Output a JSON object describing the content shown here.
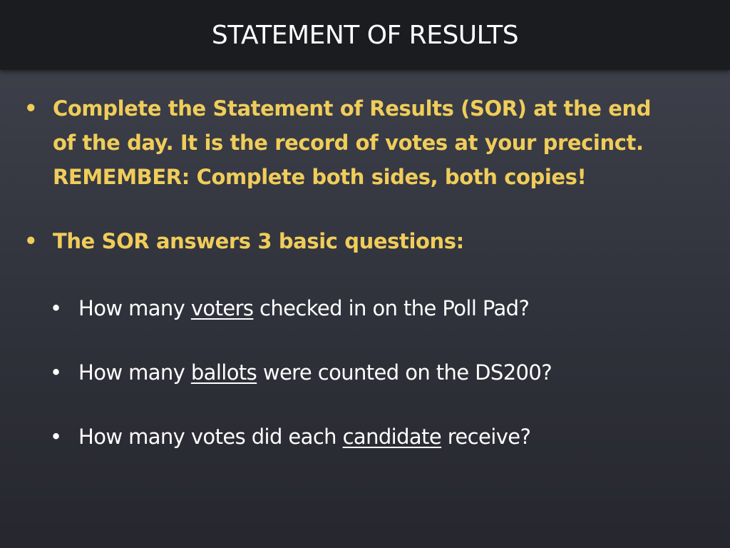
{
  "slide": {
    "title": "STATEMENT OF RESULTS",
    "bullets": [
      {
        "lines": [
          "Complete the Statement of Results (SOR) at the end",
          "of the day. It is the record of votes at your precinct.",
          "REMEMBER: Complete both sides, both copies!"
        ]
      },
      {
        "text": "The SOR answers 3 basic questions:"
      }
    ],
    "sub_bullets": [
      {
        "before": "How many ",
        "underlined": "voters",
        "after": " checked in on the Poll Pad?"
      },
      {
        "before": "How many ",
        "underlined": "ballots",
        "after": " were counted on the DS200?"
      },
      {
        "before": "How many votes did each ",
        "underlined": "candidate",
        "after": " receive?"
      }
    ],
    "bullet_glyph": "•",
    "colors": {
      "title_bar": "#1b1c1f",
      "title_text": "#ffffff",
      "highlight_text": "#f0cd5a",
      "body_text": "#ffffff",
      "background": "#33353f"
    }
  }
}
